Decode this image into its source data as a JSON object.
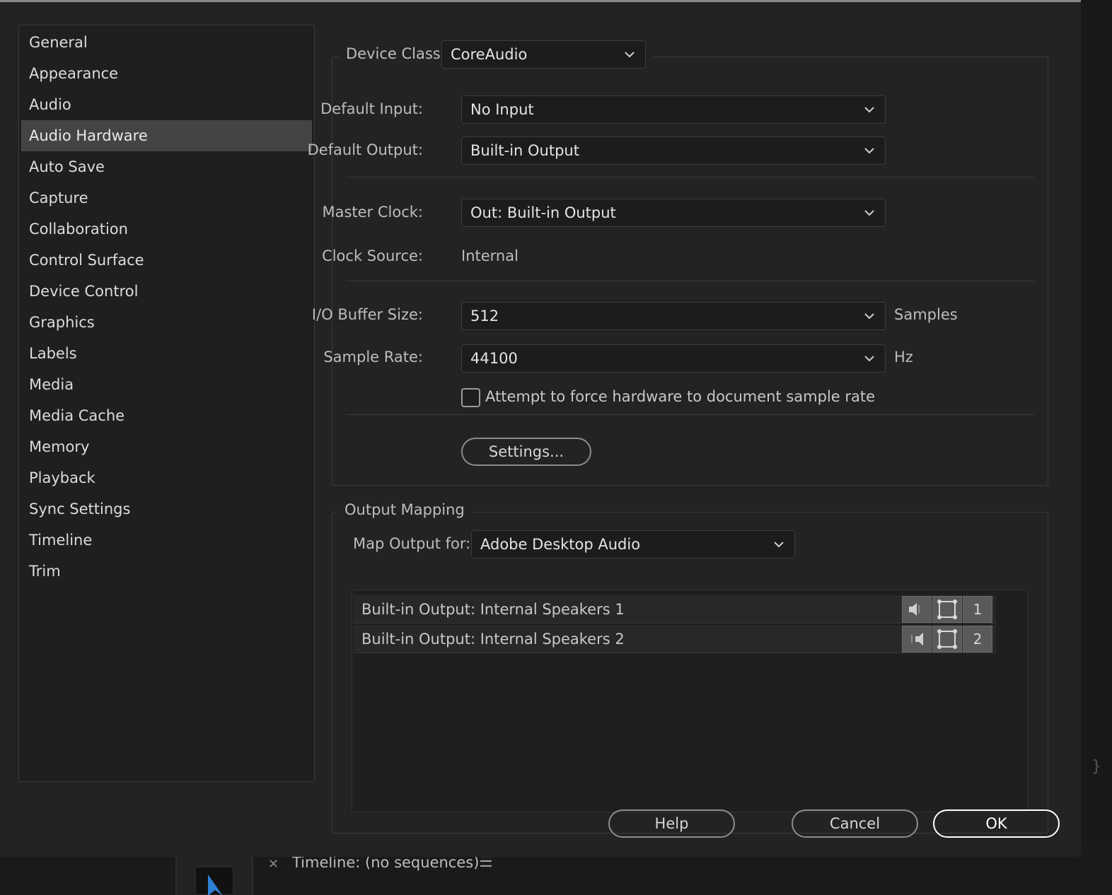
{
  "sidebar": {
    "items": [
      {
        "label": "General"
      },
      {
        "label": "Appearance"
      },
      {
        "label": "Audio"
      },
      {
        "label": "Audio Hardware",
        "selected": true
      },
      {
        "label": "Auto Save"
      },
      {
        "label": "Capture"
      },
      {
        "label": "Collaboration"
      },
      {
        "label": "Control Surface"
      },
      {
        "label": "Device Control"
      },
      {
        "label": "Graphics"
      },
      {
        "label": "Labels"
      },
      {
        "label": "Media"
      },
      {
        "label": "Media Cache"
      },
      {
        "label": "Memory"
      },
      {
        "label": "Playback"
      },
      {
        "label": "Sync Settings"
      },
      {
        "label": "Timeline"
      },
      {
        "label": "Trim"
      }
    ]
  },
  "device": {
    "class_label": "Device Class:",
    "class_value": "CoreAudio",
    "default_input_label": "Default Input:",
    "default_input_value": "No Input",
    "default_output_label": "Default Output:",
    "default_output_value": "Built-in Output",
    "master_clock_label": "Master Clock:",
    "master_clock_value": "Out: Built-in Output",
    "clock_source_label": "Clock Source:",
    "clock_source_value": "Internal",
    "buffer_label": "I/O Buffer Size:",
    "buffer_value": "512",
    "buffer_unit": "Samples",
    "sample_rate_label": "Sample Rate:",
    "sample_rate_value": "44100",
    "sample_rate_unit": "Hz",
    "force_rate_label": "Attempt to force hardware to document sample rate",
    "force_rate_checked": false,
    "settings_button": "Settings..."
  },
  "output_mapping": {
    "legend": "Output Mapping",
    "map_for_label": "Map Output for:",
    "map_for_value": "Adobe Desktop Audio",
    "rows": [
      {
        "label": "Built-in Output: Internal Speakers 1",
        "channel": "1"
      },
      {
        "label": "Built-in Output: Internal Speakers 2",
        "channel": "2"
      }
    ]
  },
  "footer": {
    "help": "Help",
    "cancel": "Cancel",
    "ok": "OK"
  },
  "background": {
    "timeline_title": "Timeline: (no sequences)"
  },
  "colors": {
    "dialog_bg": "#232323",
    "selected_item": "#444444",
    "dropdown_bg": "#1c1c1c",
    "tool_accent": "#2f80d6"
  }
}
